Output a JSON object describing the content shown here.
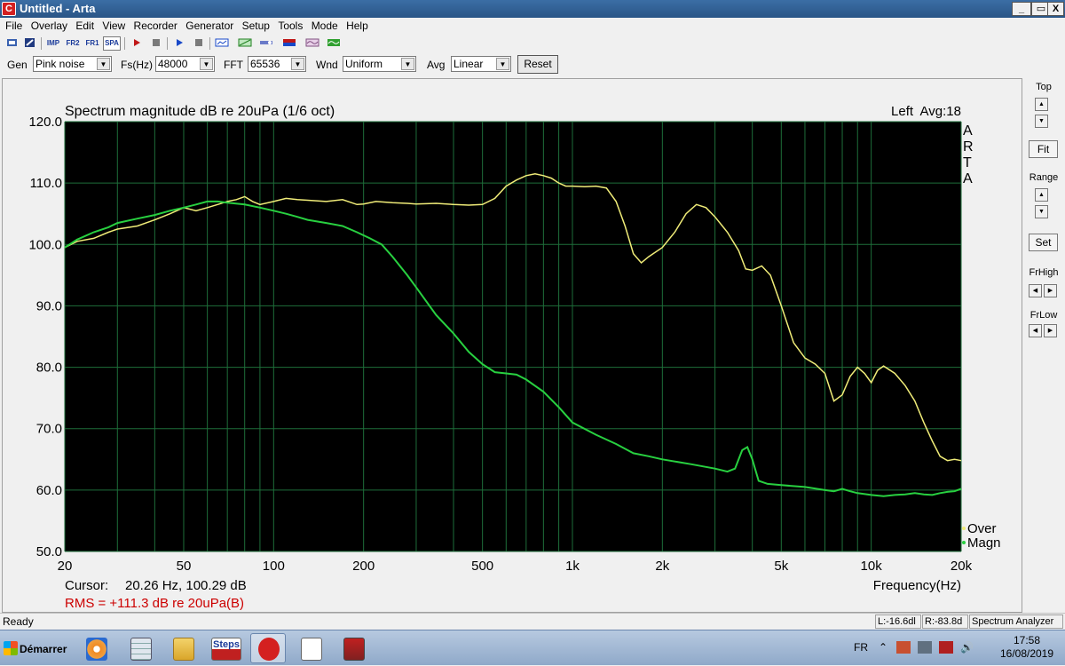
{
  "window": {
    "title": "Untitled - Arta",
    "app_icon": "arta-icon",
    "controls": [
      "_",
      "▭",
      "X"
    ]
  },
  "menu": [
    "File",
    "Overlay",
    "Edit",
    "View",
    "Recorder",
    "Generator",
    "Setup",
    "Tools",
    "Mode",
    "Help"
  ],
  "toolbar1": {
    "impulse_label": "IMP",
    "fr2_label": "FR2",
    "fr1_label": "FR1",
    "spa_label": "SPA"
  },
  "toolbar2": {
    "gen_label": "Gen",
    "gen_value": "Pink noise",
    "fs_label": "Fs(Hz)",
    "fs_value": "48000",
    "fft_label": "FFT",
    "fft_value": "65536",
    "wnd_label": "Wnd",
    "wnd_value": "Uniform",
    "avg_label": "Avg",
    "avg_value": "Linear",
    "reset_label": "Reset"
  },
  "side_panel": {
    "top_label": "Top",
    "fit_label": "Fit",
    "range_label": "Range",
    "set_label": "Set",
    "frhigh_label": "FrHigh",
    "frlow_label": "FrLow"
  },
  "plot": {
    "channel_info": "Left  Avg:18",
    "arta_letters": [
      "A",
      "R",
      "T",
      "A"
    ],
    "cursor_label": "Cursor:",
    "cursor_value": "20.26 Hz, 100.29 dB",
    "rms_text": "RMS = +111.3 dB re 20uPa(B)",
    "colors": {
      "background": "#000000",
      "grid": "#1e6e3a",
      "series_over": "#f0ec78",
      "series_magn": "#28d040",
      "rms_text": "#cc0000"
    }
  },
  "chart_data": {
    "type": "line",
    "title": "Spectrum magnitude dB re 20uPa (1/6 oct)",
    "xlabel": "Frequency(Hz)",
    "ylabel": "",
    "x_scale": "log",
    "xlim": [
      20,
      20000
    ],
    "ylim": [
      50,
      120
    ],
    "grid": true,
    "legend_position": "bottom-right",
    "x_tick_labels": [
      "20",
      "50",
      "100",
      "200",
      "500",
      "1k",
      "2k",
      "5k",
      "10k",
      "20k"
    ],
    "x_tick_values": [
      20,
      50,
      100,
      200,
      500,
      1000,
      2000,
      5000,
      10000,
      20000
    ],
    "y_tick_labels": [
      "120.0",
      "110.0",
      "100.0",
      "90.0",
      "80.0",
      "70.0",
      "60.0",
      "50.0"
    ],
    "y_tick_values": [
      120,
      110,
      100,
      90,
      80,
      70,
      60,
      50
    ],
    "series": [
      {
        "name": "Over",
        "points": [
          [
            20,
            99.5
          ],
          [
            22,
            100.5
          ],
          [
            25,
            101
          ],
          [
            28,
            102
          ],
          [
            30,
            102.5
          ],
          [
            35,
            103
          ],
          [
            40,
            104
          ],
          [
            45,
            105
          ],
          [
            50,
            106
          ],
          [
            55,
            105.5
          ],
          [
            60,
            106
          ],
          [
            65,
            106.5
          ],
          [
            70,
            107
          ],
          [
            75,
            107.3
          ],
          [
            80,
            107.8
          ],
          [
            85,
            107
          ],
          [
            90,
            106.5
          ],
          [
            100,
            107
          ],
          [
            110,
            107.5
          ],
          [
            120,
            107.3
          ],
          [
            130,
            107.2
          ],
          [
            150,
            107
          ],
          [
            170,
            107.3
          ],
          [
            190,
            106.5
          ],
          [
            200,
            106.6
          ],
          [
            220,
            107
          ],
          [
            250,
            106.8
          ],
          [
            280,
            106.7
          ],
          [
            300,
            106.6
          ],
          [
            350,
            106.7
          ],
          [
            400,
            106.5
          ],
          [
            450,
            106.4
          ],
          [
            500,
            106.5
          ],
          [
            550,
            107.5
          ],
          [
            600,
            109.5
          ],
          [
            650,
            110.5
          ],
          [
            700,
            111.2
          ],
          [
            750,
            111.5
          ],
          [
            800,
            111.2
          ],
          [
            850,
            110.8
          ],
          [
            900,
            110
          ],
          [
            950,
            109.5
          ],
          [
            1000,
            109.5
          ],
          [
            1100,
            109.4
          ],
          [
            1200,
            109.5
          ],
          [
            1300,
            109.2
          ],
          [
            1400,
            107
          ],
          [
            1500,
            103
          ],
          [
            1600,
            98.5
          ],
          [
            1700,
            97
          ],
          [
            1800,
            98
          ],
          [
            2000,
            99.5
          ],
          [
            2200,
            102
          ],
          [
            2400,
            105
          ],
          [
            2600,
            106.5
          ],
          [
            2800,
            106
          ],
          [
            3000,
            104.5
          ],
          [
            3300,
            102
          ],
          [
            3600,
            99
          ],
          [
            3800,
            96
          ],
          [
            4000,
            95.8
          ],
          [
            4300,
            96.5
          ],
          [
            4600,
            95
          ],
          [
            5000,
            90
          ],
          [
            5500,
            84
          ],
          [
            6000,
            81.5
          ],
          [
            6500,
            80.5
          ],
          [
            7000,
            79
          ],
          [
            7500,
            74.5
          ],
          [
            8000,
            75.5
          ],
          [
            8500,
            78.5
          ],
          [
            9000,
            80
          ],
          [
            9500,
            79
          ],
          [
            10000,
            77.5
          ],
          [
            10500,
            79.5
          ],
          [
            11000,
            80.2
          ],
          [
            12000,
            79
          ],
          [
            13000,
            77
          ],
          [
            14000,
            74.5
          ],
          [
            15000,
            71
          ],
          [
            16000,
            68
          ],
          [
            17000,
            65.5
          ],
          [
            18000,
            64.8
          ],
          [
            19000,
            65
          ],
          [
            20000,
            64.8
          ]
        ]
      },
      {
        "name": "Magn",
        "points": [
          [
            20,
            99.5
          ],
          [
            22,
            100.8
          ],
          [
            25,
            102
          ],
          [
            28,
            102.8
          ],
          [
            30,
            103.5
          ],
          [
            35,
            104.2
          ],
          [
            40,
            104.8
          ],
          [
            45,
            105.5
          ],
          [
            50,
            106
          ],
          [
            55,
            106.5
          ],
          [
            60,
            107
          ],
          [
            65,
            107
          ],
          [
            70,
            106.8
          ],
          [
            80,
            106.5
          ],
          [
            90,
            106
          ],
          [
            100,
            105.5
          ],
          [
            110,
            105
          ],
          [
            120,
            104.5
          ],
          [
            130,
            104
          ],
          [
            150,
            103.5
          ],
          [
            170,
            103
          ],
          [
            190,
            102
          ],
          [
            210,
            101
          ],
          [
            230,
            100
          ],
          [
            250,
            98
          ],
          [
            280,
            95
          ],
          [
            300,
            93
          ],
          [
            350,
            88.5
          ],
          [
            400,
            85.5
          ],
          [
            450,
            82.5
          ],
          [
            500,
            80.5
          ],
          [
            550,
            79.2
          ],
          [
            600,
            79
          ],
          [
            650,
            78.8
          ],
          [
            700,
            78
          ],
          [
            800,
            76
          ],
          [
            900,
            73.5
          ],
          [
            1000,
            71
          ],
          [
            1200,
            69
          ],
          [
            1400,
            67.5
          ],
          [
            1600,
            66
          ],
          [
            1800,
            65.5
          ],
          [
            2000,
            65
          ],
          [
            2500,
            64.2
          ],
          [
            3000,
            63.5
          ],
          [
            3300,
            63
          ],
          [
            3500,
            63.5
          ],
          [
            3700,
            66.5
          ],
          [
            3850,
            67
          ],
          [
            4000,
            65
          ],
          [
            4200,
            61.5
          ],
          [
            4500,
            61
          ],
          [
            5000,
            60.8
          ],
          [
            6000,
            60.5
          ],
          [
            7000,
            60
          ],
          [
            7500,
            59.8
          ],
          [
            8000,
            60.2
          ],
          [
            8500,
            59.8
          ],
          [
            9000,
            59.5
          ],
          [
            10000,
            59.2
          ],
          [
            11000,
            59
          ],
          [
            12000,
            59.2
          ],
          [
            13000,
            59.3
          ],
          [
            14000,
            59.5
          ],
          [
            15000,
            59.3
          ],
          [
            16000,
            59.2
          ],
          [
            17000,
            59.5
          ],
          [
            18000,
            59.7
          ],
          [
            19000,
            59.8
          ],
          [
            20000,
            60.2
          ]
        ]
      }
    ]
  },
  "status": {
    "ready": "Ready",
    "left_level": "L:-16.6dl",
    "right_level": "R:-83.8d",
    "mode": "Spectrum Analyzer"
  },
  "taskbar": {
    "start_label": "Démarrer",
    "steps_label": "Steps",
    "lang": "FR",
    "time": "17:58",
    "date": "16/08/2019"
  }
}
